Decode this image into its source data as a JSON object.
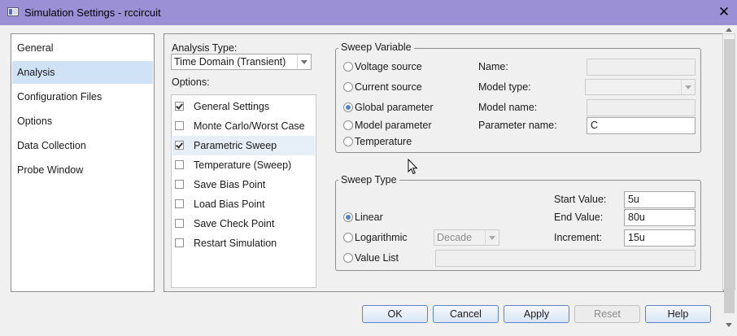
{
  "window": {
    "title": "Simulation Settings - rccircuit"
  },
  "nav": {
    "items": [
      {
        "label": "General",
        "selected": false
      },
      {
        "label": "Analysis",
        "selected": true
      },
      {
        "label": "Configuration Files",
        "selected": false
      },
      {
        "label": "Options",
        "selected": false
      },
      {
        "label": "Data Collection",
        "selected": false
      },
      {
        "label": "Probe Window",
        "selected": false
      }
    ]
  },
  "analysis": {
    "type_label": "Analysis Type:",
    "type_value": "Time Domain (Transient)",
    "options_label": "Options:",
    "options": [
      {
        "label": "General Settings",
        "checked": true
      },
      {
        "label": "Monte Carlo/Worst Case",
        "checked": false
      },
      {
        "label": "Parametric Sweep",
        "checked": true
      },
      {
        "label": "Temperature (Sweep)",
        "checked": false
      },
      {
        "label": "Save Bias Point",
        "checked": false
      },
      {
        "label": "Load Bias Point",
        "checked": false
      },
      {
        "label": "Save Check Point",
        "checked": false
      },
      {
        "label": "Restart Simulation",
        "checked": false
      }
    ]
  },
  "sweep_variable": {
    "title": "Sweep Variable",
    "radios": [
      {
        "label": "Voltage source",
        "selected": false
      },
      {
        "label": "Current source",
        "selected": false
      },
      {
        "label": "Global parameter",
        "selected": true
      },
      {
        "label": "Model parameter",
        "selected": false
      },
      {
        "label": "Temperature",
        "selected": false
      }
    ],
    "name_label": "Name:",
    "name_value": "",
    "model_type_label": "Model type:",
    "model_type_value": "",
    "model_name_label": "Model name:",
    "model_name_value": "",
    "param_name_label": "Parameter name:",
    "param_name_value": "C"
  },
  "sweep_type": {
    "title": "Sweep Type",
    "radios": [
      {
        "label": "Linear",
        "selected": true
      },
      {
        "label": "Logarithmic",
        "selected": false
      },
      {
        "label": "Value List",
        "selected": false
      }
    ],
    "log_scale_value": "Decade",
    "value_list_value": "",
    "start_label": "Start Value:",
    "start_value": "5u",
    "end_label": "End Value:",
    "end_value": "80u",
    "increment_label": "Increment:",
    "increment_value": "15u"
  },
  "buttons": {
    "ok": "OK",
    "cancel": "Cancel",
    "apply": "Apply",
    "reset": "Reset",
    "help": "Help"
  },
  "colors": {
    "titlebar": "#9b8fd6",
    "selection": "#cfe2f6",
    "button_border": "#5c85c8",
    "radio_dot": "#4a86c8"
  }
}
